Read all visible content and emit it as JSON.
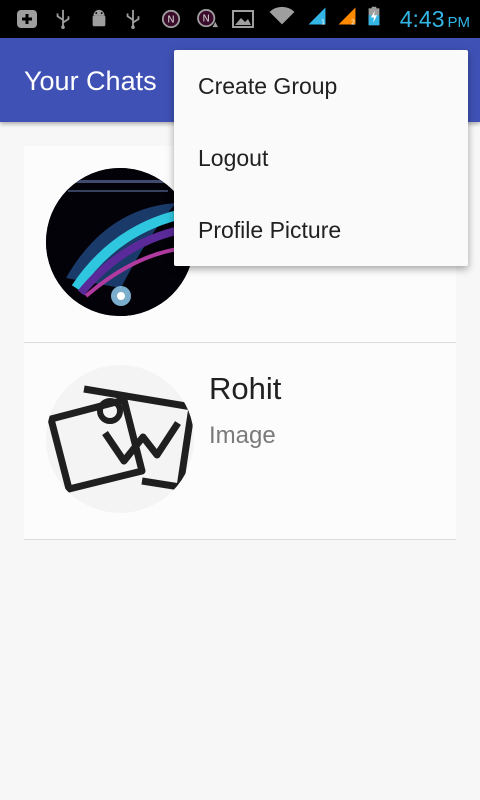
{
  "status_bar": {
    "time": "4:43",
    "ampm": "PM",
    "icons": [
      "add-box-icon",
      "usb-icon",
      "android-debug-icon",
      "usb-icon",
      "notification-n-icon",
      "notification-n-icon",
      "image-icon",
      "wifi-icon",
      "signal-icon",
      "signal-icon",
      "battery-charging-icon"
    ]
  },
  "app_bar": {
    "title": "Your Chats"
  },
  "chats": [
    {
      "name": "",
      "preview": "",
      "avatar": "photo-avatar"
    },
    {
      "name": "Rohit",
      "preview": "Image",
      "avatar": "image-placeholder-icon"
    }
  ],
  "overflow_menu": {
    "items": [
      {
        "label": "Create Group"
      },
      {
        "label": "Logout"
      },
      {
        "label": "Profile Picture"
      }
    ]
  },
  "colors": {
    "primary": "#3f51b5",
    "status_time": "#33b5e5",
    "background": "#f7f7f7"
  }
}
